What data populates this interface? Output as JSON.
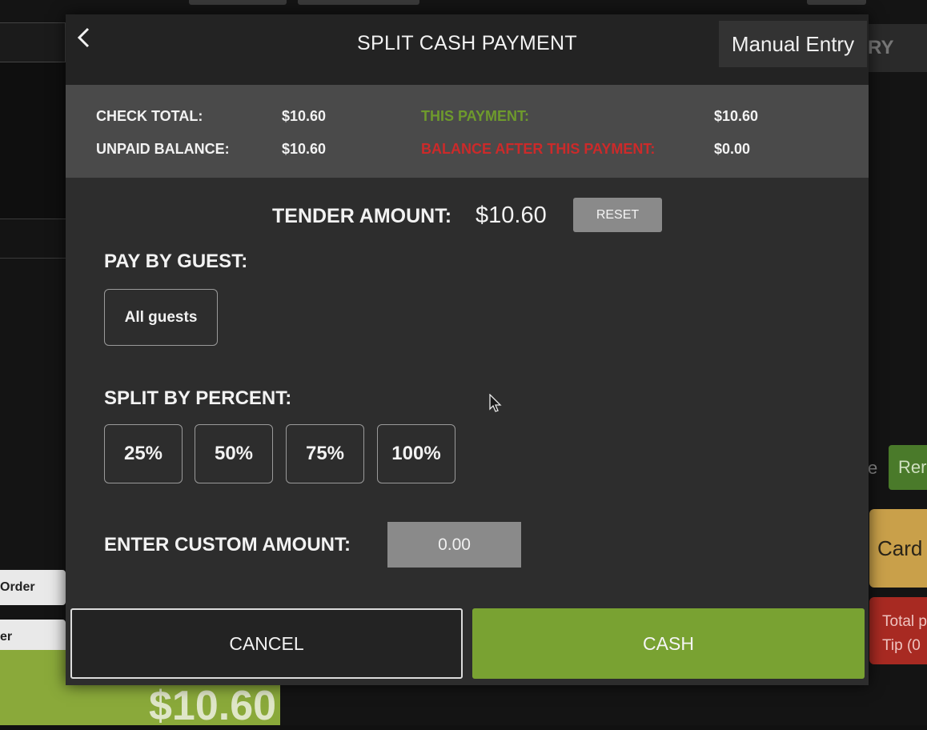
{
  "background": {
    "left_buttons": [
      "Order",
      "er"
    ],
    "big_total": "$10.60",
    "right_partial_title": "RY",
    "right_partial_e": "e",
    "right_partial_green": "Rer",
    "right_partial_card": "Card",
    "right_partial_total_line1": "Total p",
    "right_partial_total_line2": "Tip (0"
  },
  "modal": {
    "title": "SPLIT CASH PAYMENT",
    "manual_entry_label": "Manual Entry",
    "summary": {
      "check_total_label": "CHECK TOTAL:",
      "check_total_value": "$10.60",
      "unpaid_balance_label": "UNPAID BALANCE:",
      "unpaid_balance_value": "$10.60",
      "this_payment_label": "THIS PAYMENT:",
      "this_payment_value": "$10.60",
      "balance_after_label": "BALANCE AFTER THIS PAYMENT:",
      "balance_after_value": "$0.00"
    },
    "tender_label": "TENDER AMOUNT:",
    "tender_value": "$10.60",
    "reset_label": "RESET",
    "pay_by_guest_label": "PAY BY GUEST:",
    "guest_options": [
      "All guests"
    ],
    "split_by_percent_label": "SPLIT BY PERCENT:",
    "percent_options": [
      "25%",
      "50%",
      "75%",
      "100%"
    ],
    "custom_amount_label": "ENTER CUSTOM AMOUNT:",
    "custom_amount_placeholder": "0.00",
    "cancel_label": "CANCEL",
    "cash_label": "CASH"
  },
  "colors": {
    "accent_green": "#79a232",
    "this_payment_green": "#6e9a2c",
    "balance_red": "#cc2a2a",
    "modal_bg": "#2d2d2d",
    "summary_bg": "#4a4a4a"
  }
}
